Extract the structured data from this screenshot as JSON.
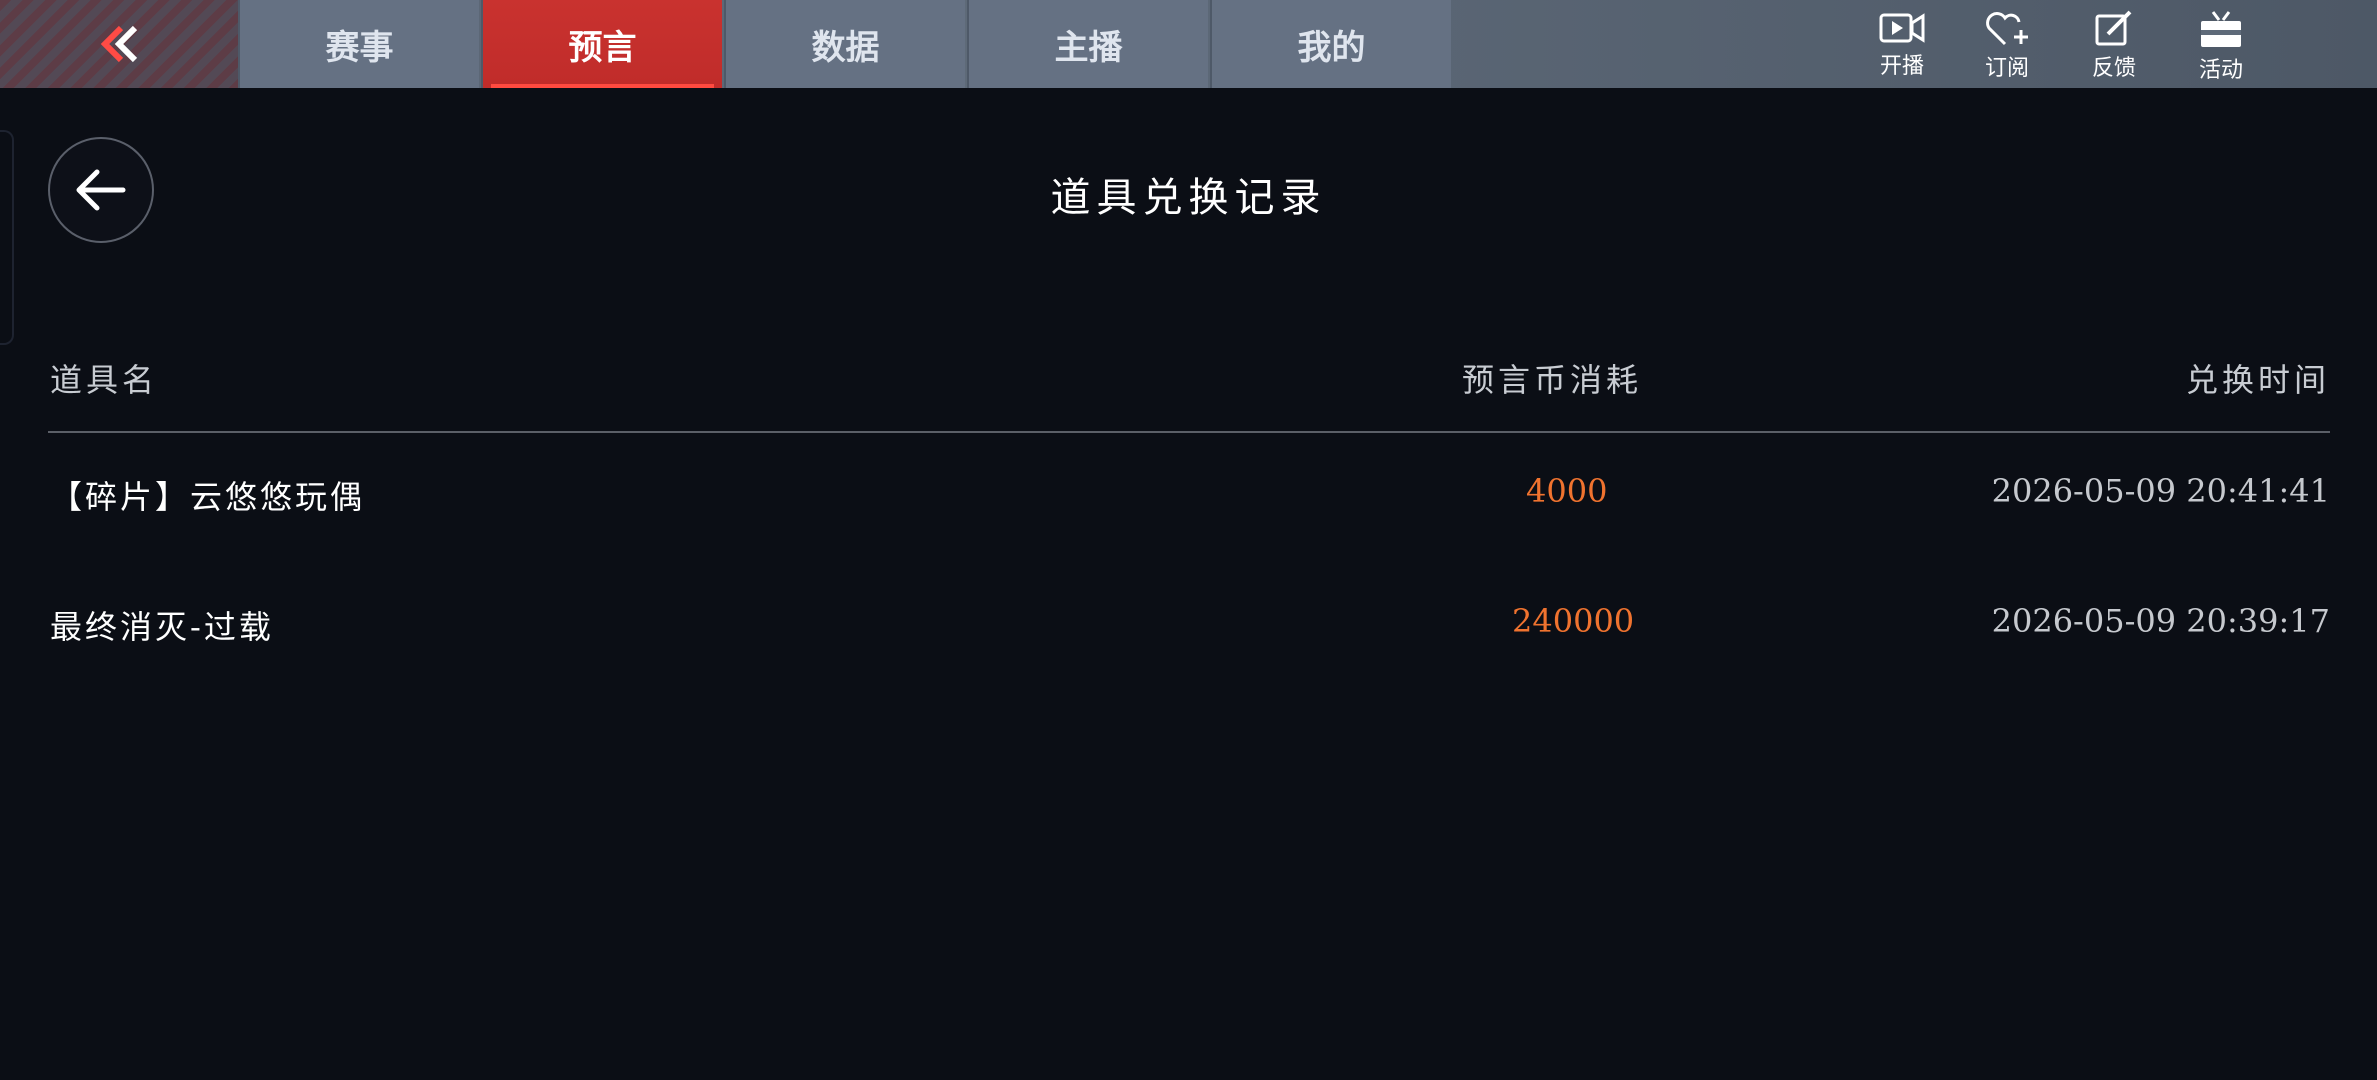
{
  "nav": {
    "tabs": [
      {
        "label": "赛事",
        "active": false
      },
      {
        "label": "预言",
        "active": true
      },
      {
        "label": "数据",
        "active": false
      },
      {
        "label": "主播",
        "active": false
      },
      {
        "label": "我的",
        "active": false
      }
    ],
    "tools": [
      {
        "label": "开播",
        "icon": "video-camera-icon"
      },
      {
        "label": "订阅",
        "icon": "heart-plus-icon"
      },
      {
        "label": "反馈",
        "icon": "edit-icon"
      },
      {
        "label": "活动",
        "icon": "tv-gift-icon"
      }
    ],
    "accent": "#c9322f"
  },
  "page": {
    "title": "道具兑换记录"
  },
  "table": {
    "headers": [
      "道具名",
      "预言币消耗",
      "兑换时间"
    ],
    "rows": [
      {
        "name": "【碎片】云悠悠玩偶",
        "cost": "4000",
        "time": "2026-05-09 20:41:41"
      },
      {
        "name": "最终消灭-过载",
        "cost": "240000",
        "time": "2026-05-09 20:39:17"
      }
    ],
    "cost_color": "#f0732f"
  }
}
